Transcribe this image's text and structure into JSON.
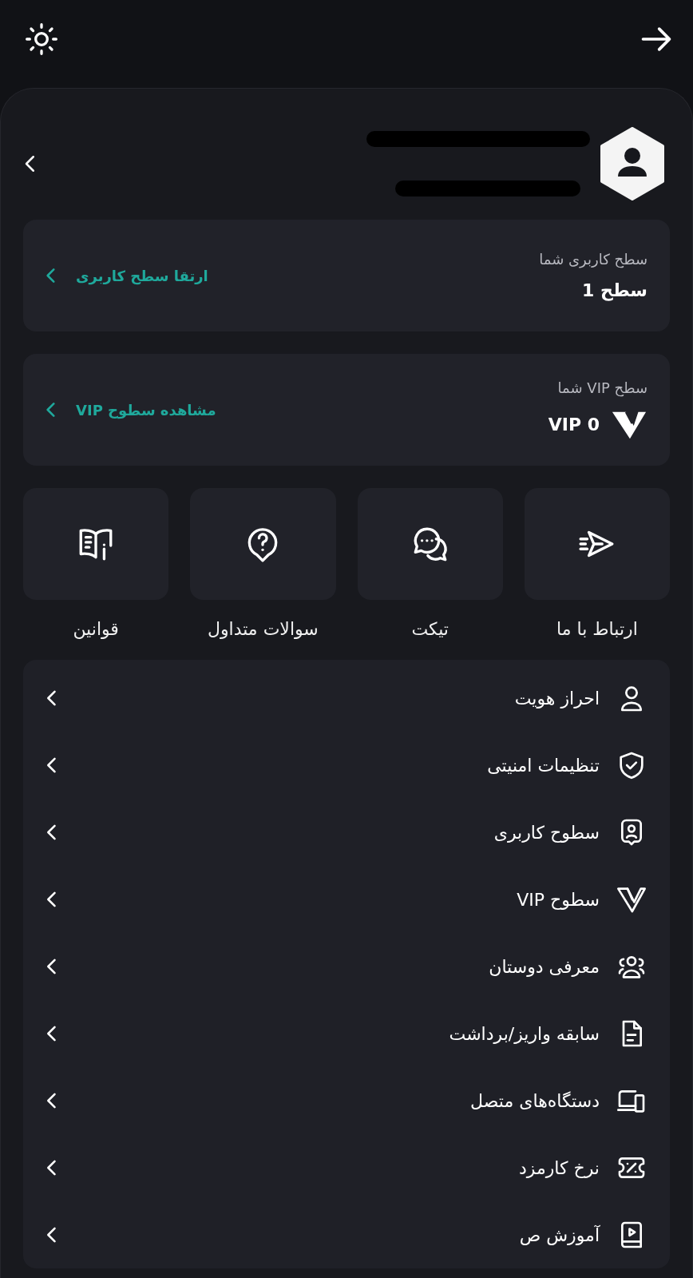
{
  "user_level": {
    "label": "سطح کاربری شما",
    "value": "سطح 1",
    "action": "ارتقا سطح کاربری"
  },
  "vip_level": {
    "label": "سطح VIP شما",
    "value": "VIP 0",
    "action": "مشاهده سطوح VIP"
  },
  "shortcuts": [
    {
      "label": "ارتباط با ما"
    },
    {
      "label": "تیکت"
    },
    {
      "label": "سوالات متداول"
    },
    {
      "label": "قوانین"
    }
  ],
  "menu": [
    {
      "label": "احراز هویت"
    },
    {
      "label": "تنظیمات امنیتی"
    },
    {
      "label": "سطوح کاربری"
    },
    {
      "label": "سطوح VIP"
    },
    {
      "label": "معرفی دوستان"
    },
    {
      "label": "سابقه واریز/برداشت"
    },
    {
      "label": "دستگاه‌های متصل"
    },
    {
      "label": "نرخ کارمزد"
    },
    {
      "label": "آموزش ص"
    }
  ]
}
